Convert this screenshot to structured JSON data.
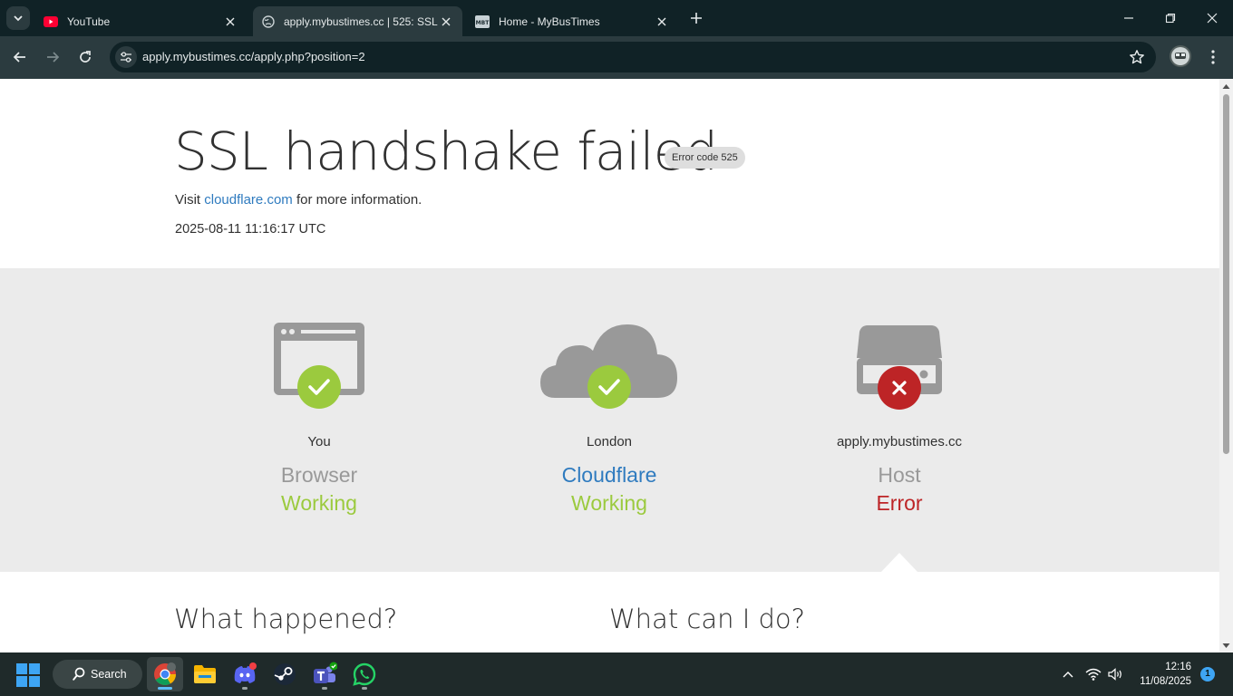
{
  "browser": {
    "tabs": [
      {
        "title": "YouTube",
        "favicon": "youtube-icon",
        "active": false
      },
      {
        "title": "apply.mybustimes.cc | 525: SSL",
        "favicon": "globe-icon",
        "active": true
      },
      {
        "title": "Home - MyBusTimes",
        "favicon": "mbt-icon",
        "active": false
      }
    ],
    "url": "apply.mybustimes.cc/apply.php?position=2"
  },
  "page": {
    "headline": "SSL handshake failed",
    "error_code": "Error code 525",
    "visit_prefix": "Visit ",
    "visit_link": "cloudflare.com",
    "visit_suffix": " for more information.",
    "timestamp": "2025-08-11 11:16:17 UTC",
    "status": [
      {
        "location": "You",
        "name": "Browser",
        "state": "Working",
        "ok": true,
        "icon": "browser-icon"
      },
      {
        "location": "London",
        "name": "Cloudflare",
        "state": "Working",
        "ok": true,
        "icon": "cloud-icon"
      },
      {
        "location": "apply.mybustimes.cc",
        "name": "Host",
        "state": "Error",
        "ok": false,
        "icon": "server-icon"
      }
    ],
    "what_happened": "What happened?",
    "what_can_i_do": "What can I do?"
  },
  "colors": {
    "ok": "#9bca3e",
    "error": "#bd2426",
    "link": "#2f7bbf",
    "icon_grey": "#999999"
  },
  "taskbar": {
    "search_label": "Search",
    "apps": [
      "chrome-icon",
      "file-explorer-icon",
      "discord-icon",
      "steam-icon",
      "teams-icon",
      "whatsapp-icon"
    ],
    "time": "12:16",
    "date": "11/08/2025",
    "notifications": "1"
  }
}
